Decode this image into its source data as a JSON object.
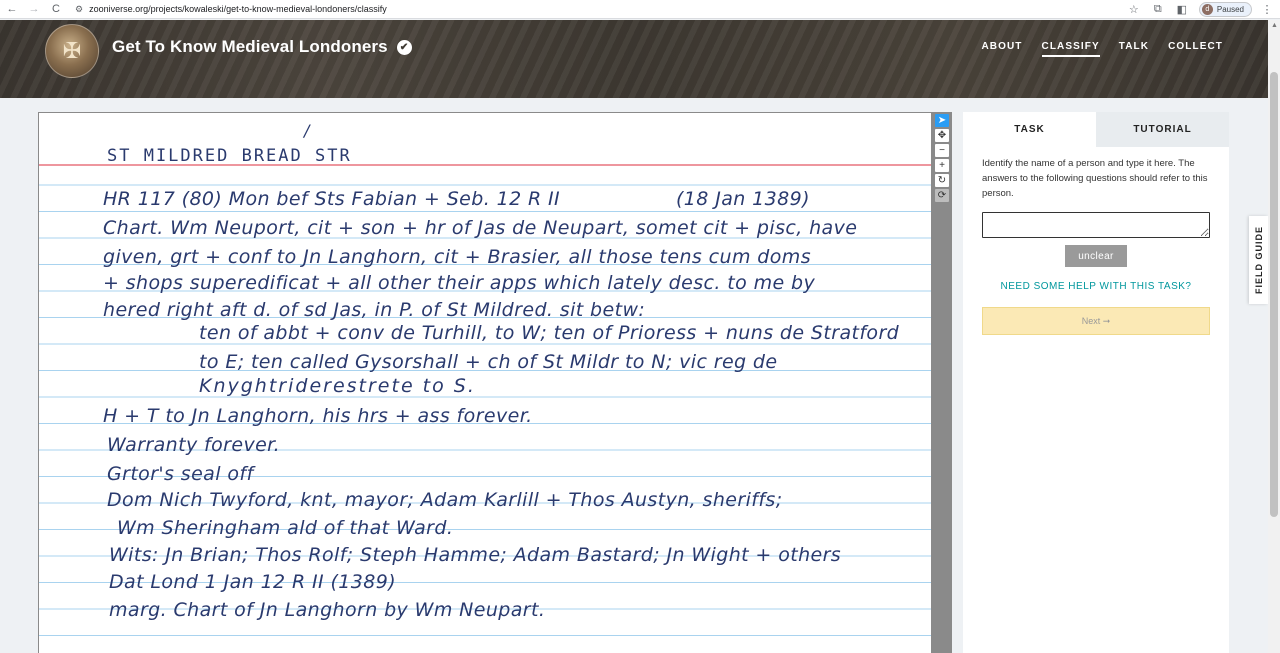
{
  "browser": {
    "url": "zooniverse.org/projects/kowaleski/get-to-know-medieval-londoners/classify",
    "profile_initial": "d",
    "profile_status": "Paused"
  },
  "project": {
    "title": "Get To Know Medieval Londoners",
    "nav": [
      {
        "label": "ABOUT",
        "active": false
      },
      {
        "label": "CLASSIFY",
        "active": true
      },
      {
        "label": "TALK",
        "active": false
      },
      {
        "label": "COLLECT",
        "active": false
      }
    ]
  },
  "document": {
    "tick_mark": "/",
    "heading": "ST MILDRED BREAD STR",
    "lines": [
      "HR 117 (80) Mon bef Sts Fabian + Seb. 12 R II                  (18 Jan 1389)",
      "Chart. Wm Neuport, cit + son + hr of Jas de Neupart, somet cit + pisc, have",
      "given, grt + conf to Jn Langhorn, cit + Brasier, all those tens cum doms",
      "+ shops superedificat + all other their apps which lately desc. to me by",
      "hered right aft d. of sd Jas, in P. of St Mildred. sit betw:",
      "ten of abbt + conv de Turhill, to W; ten of Prioress + nuns de Stratford",
      "to E; ten called Gysorshall + ch of St Mildr to N; vic reg de",
      "Knyghtriderestrete to S.",
      "H + T to Jn Langhorn, his hrs + ass forever.",
      "Warranty forever.",
      "Grtor's seal off",
      "Dom Nich Twyford, knt, mayor; Adam Karlill + Thos Austyn, sheriffs;",
      "Wm Sheringham ald of that Ward.",
      "Wits: Jn Brian; Thos Rolf; Steph Hamme; Adam Bastard; Jn Wight + others",
      "Dat Lond 1 Jan 12 R II (1389)",
      "marg. Chart of Jn Langhorn by Wm Neupart."
    ]
  },
  "task": {
    "tab_task": "TASK",
    "tab_tutorial": "TUTORIAL",
    "instructions": "Identify the name of a person and type it here. The answers to the following questions should refer to this person.",
    "input_value": "",
    "unclear_label": "unclear",
    "help_label": "NEED SOME HELP WITH THIS TASK?",
    "next_label": "Next ➞"
  },
  "field_guide_label": "FIELD GUIDE",
  "colors": {
    "accent": "#00979d",
    "ink": "#2a3a6e",
    "red_rule": "#e8737f",
    "blue_rule": "#a9d3ef",
    "next_bg": "#fbe9b5"
  },
  "icons": {
    "back": "←",
    "forward": "→",
    "reload": "C",
    "site": "⚙",
    "star": "☆",
    "extensions": "⧉",
    "sidepanel": "◧",
    "menu": "⋮",
    "select": "➤",
    "move": "✥",
    "zoom_out": "−",
    "zoom_in": "+",
    "rotate": "↻",
    "reset": "⟳",
    "verified": "✔"
  }
}
